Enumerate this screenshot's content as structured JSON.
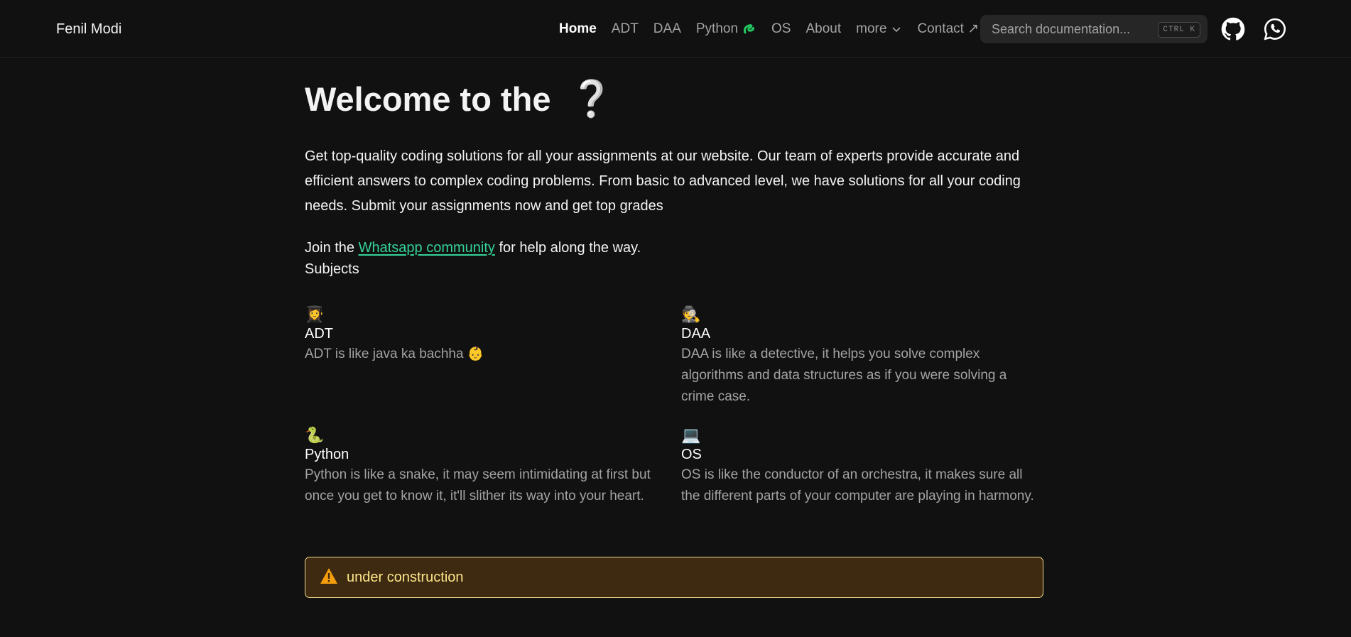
{
  "navbar": {
    "brand": "Fenil Modi",
    "links": [
      {
        "label": "Home",
        "active": true
      },
      {
        "label": "ADT"
      },
      {
        "label": "DAA"
      },
      {
        "label": "Python",
        "icon": "snake-icon"
      },
      {
        "label": "OS"
      },
      {
        "label": "About"
      },
      {
        "label": "more",
        "icon": "chevron-down-icon"
      },
      {
        "label": "Contact ↗"
      }
    ],
    "search": {
      "placeholder": "Search documentation...",
      "shortcut": "CTRL K"
    },
    "icons": [
      "github-icon",
      "whatsapp-icon"
    ]
  },
  "main": {
    "heading": "Welcome to the",
    "heading_icon": "❔",
    "intro": "Get top-quality coding solutions for all your assignments at our website. Our team of experts provide accurate and efficient answers to complex coding problems. From basic to advanced level, we have solutions for all your coding needs. Submit your assignments now and get top grades",
    "join_prefix": "Join the ",
    "join_link": "Whatsapp community",
    "join_suffix": " for help along the way.",
    "subjects_label": "Subjects",
    "subjects": [
      {
        "emoji": "👩‍🎓",
        "title": "ADT",
        "desc": "ADT is like java ka bachha 👶"
      },
      {
        "emoji": "🕵️",
        "title": "DAA",
        "desc": "DAA is like a detective, it helps you solve complex algorithms and data structures as if you were solving a crime case."
      },
      {
        "emoji": "🐍",
        "title": "Python",
        "desc": "Python is like a snake, it may seem intimidating at first but once you get to know it, it'll slither its way into your heart."
      },
      {
        "emoji": "💻",
        "title": "OS",
        "desc": "OS is like the conductor of an orchestra, it makes sure all the different parts of your computer are playing in harmony."
      }
    ]
  },
  "callout": {
    "icon": "warning-icon",
    "text": "under construction"
  },
  "colors": {
    "background": "#111111",
    "link": "#34d399",
    "warning_border": "#f0d98a",
    "warning_bg": "#3d2a10",
    "warning_text": "#fde68a"
  }
}
